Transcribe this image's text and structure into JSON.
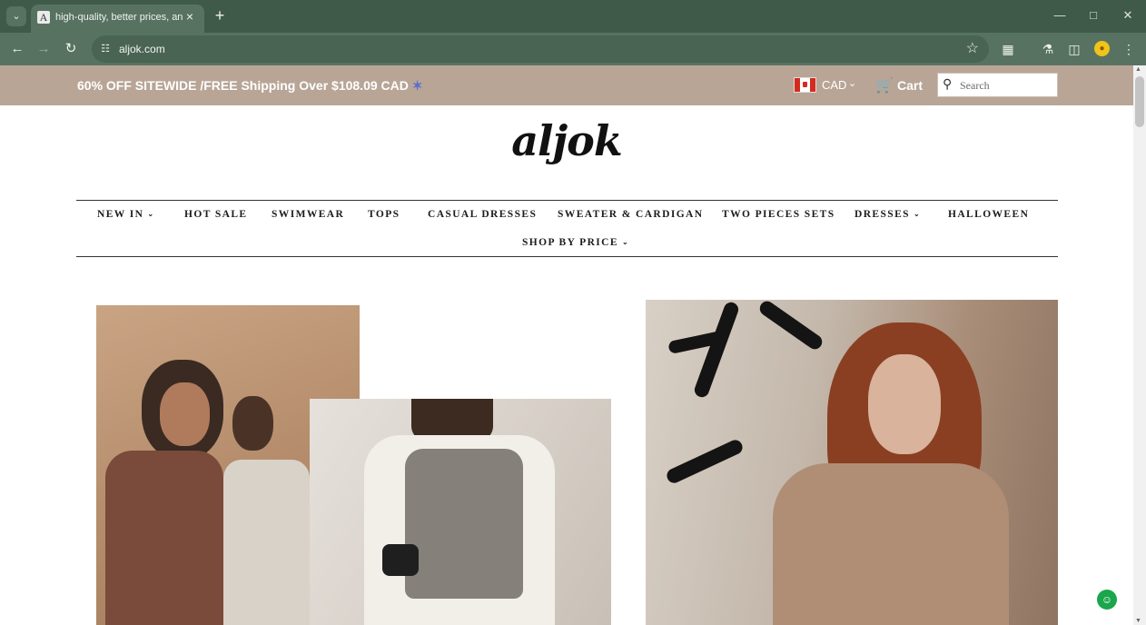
{
  "browser": {
    "tab_title": "high-quality,  better prices, and",
    "favicon_letter": "A",
    "url": "aljok.com"
  },
  "announcement": {
    "text": "60% OFF SITEWIDE /FREE Shipping Over $108.09 CAD",
    "currency": "CAD",
    "cart_label": "Cart",
    "search_placeholder": "Search"
  },
  "logo": "aljok",
  "nav": {
    "items": [
      {
        "label": "NEW IN",
        "dropdown": true
      },
      {
        "label": "HOT SALE",
        "dropdown": false
      },
      {
        "label": "SWIMWEAR",
        "dropdown": false
      },
      {
        "label": "TOPS",
        "dropdown": false
      },
      {
        "label": "CASUAL DRESSES",
        "dropdown": false
      },
      {
        "label": "SWEATER & CARDIGAN",
        "dropdown": false
      },
      {
        "label": "TWO PIECES SETS",
        "dropdown": false
      },
      {
        "label": "DRESSES",
        "dropdown": true
      },
      {
        "label": "HALLOWEEN",
        "dropdown": false
      },
      {
        "label": "SHOP BY PRICE",
        "dropdown": true
      }
    ]
  },
  "colors": {
    "chrome_dark": "#3f5a48",
    "chrome_light": "#587262",
    "announcement_bg": "#b8a596",
    "chat_green": "#1aa64b"
  },
  "icons": {
    "back": "arrow-left-icon",
    "forward": "arrow-right-icon",
    "reload": "reload-icon",
    "bookmark": "star-icon",
    "cart": "cart-icon",
    "search": "search-icon",
    "chat": "chat-icon"
  }
}
